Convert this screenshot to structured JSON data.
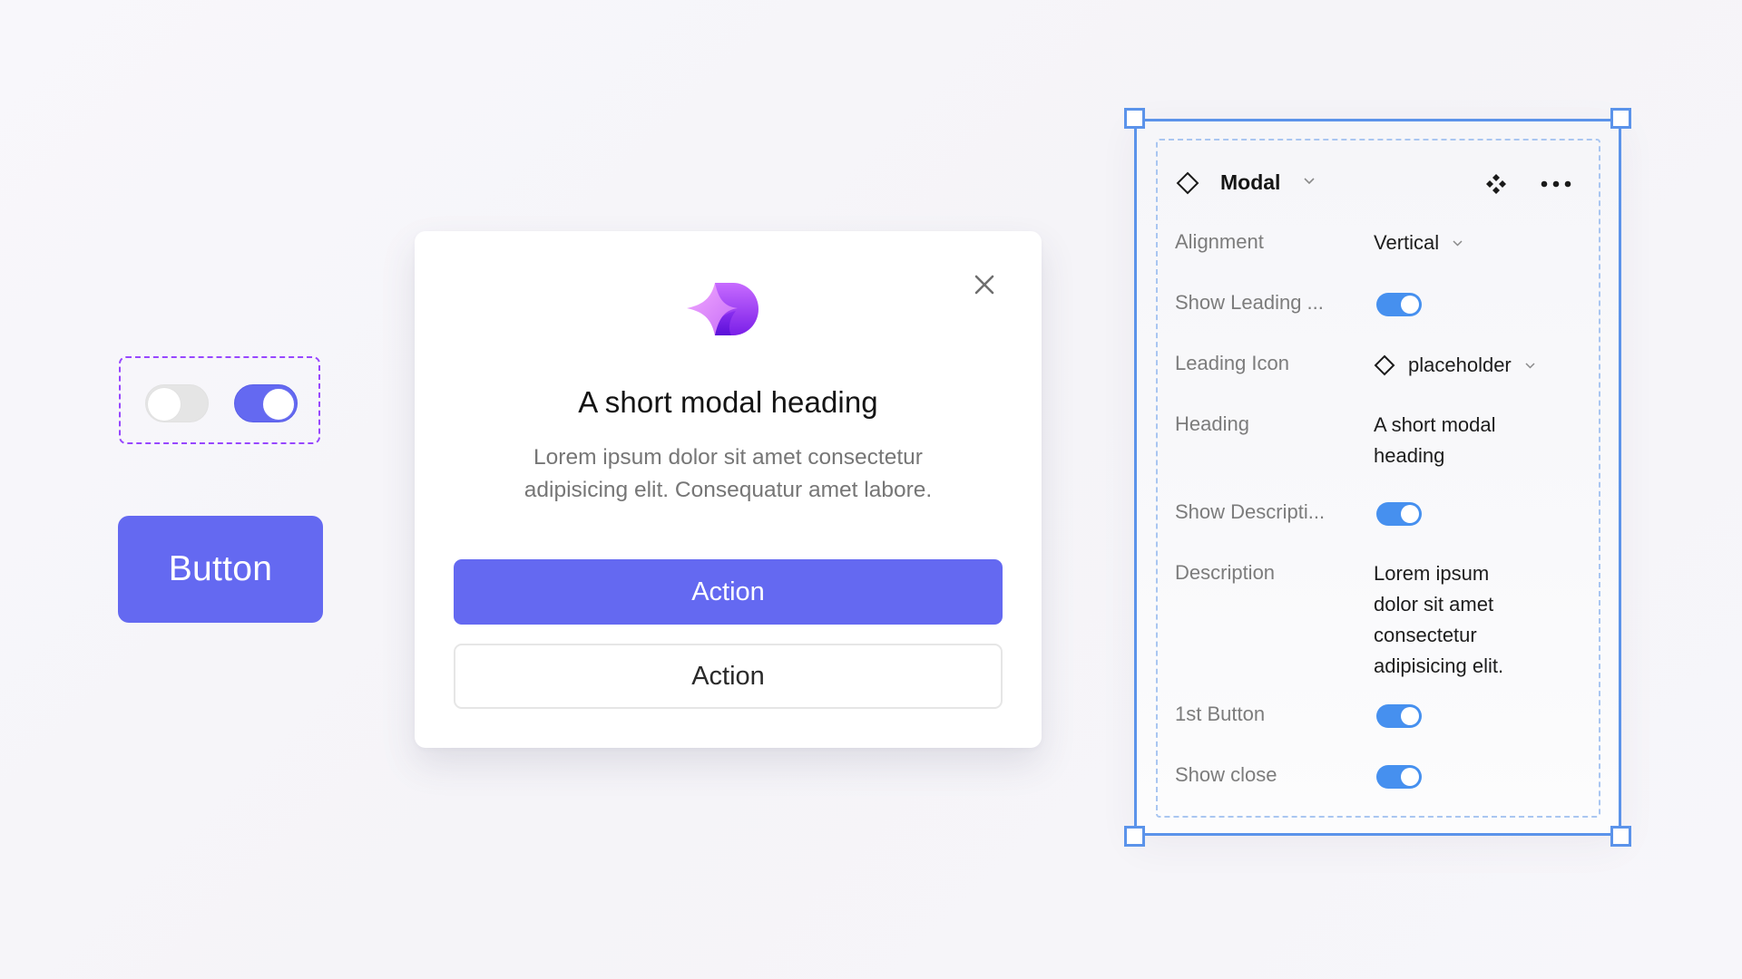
{
  "left": {
    "toggle_group": {
      "toggles": [
        {
          "state": "off"
        },
        {
          "state": "on"
        }
      ]
    },
    "button": {
      "label": "Button"
    }
  },
  "modal": {
    "logo_icon": "sparkle-logo-icon",
    "close_icon": "close-icon",
    "heading": "A short modal heading",
    "description": "Lorem ipsum dolor sit amet consectetur adipisicing elit. Consequatur amet labore.",
    "primary_action": "Action",
    "secondary_action": "Action"
  },
  "panel": {
    "component_name": "Modal",
    "icons": {
      "component": "diamond-icon",
      "chevron": "chevron-down-icon",
      "instance": "component-instance-icon",
      "more": "more-horizontal-icon"
    },
    "properties": [
      {
        "label": "Alignment",
        "type": "dropdown",
        "value": "Vertical"
      },
      {
        "label": "Show Leading ...",
        "type": "toggle",
        "value": true
      },
      {
        "label": "Leading Icon",
        "type": "icon-dropdown",
        "value": "placeholder"
      },
      {
        "label": "Heading",
        "type": "text",
        "value": "A short modal heading"
      },
      {
        "label": "Show Descripti...",
        "type": "toggle",
        "value": true
      },
      {
        "label": "Description",
        "type": "text",
        "value": "Lorem ipsum dolor sit amet consectetur adipisicing elit."
      },
      {
        "label": "1st Button",
        "type": "toggle",
        "value": true
      },
      {
        "label": "Show close",
        "type": "toggle",
        "value": true
      }
    ]
  },
  "colors": {
    "brand": "#6469F1",
    "selection": "#5B93EA",
    "toggle_on": "#4690EF",
    "group_outline": "#9747FF"
  }
}
